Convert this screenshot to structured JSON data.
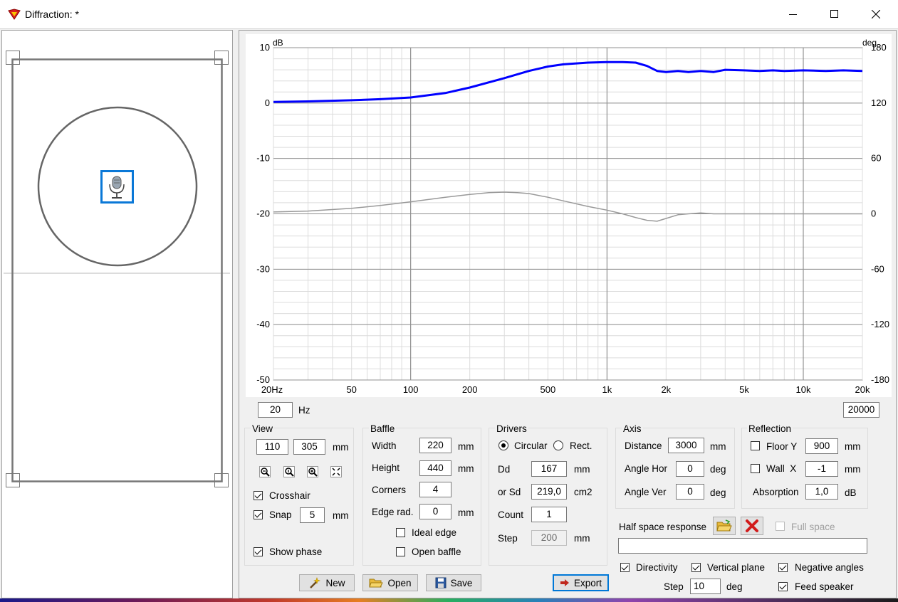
{
  "window": {
    "title": "Diffraction: *"
  },
  "chart_data": {
    "type": "line",
    "xscale": "log",
    "xlim": [
      20,
      20000
    ],
    "ylim": [
      -50,
      10
    ],
    "y2lim": [
      -180,
      180
    ],
    "ylabel": "dB",
    "y2label": "deg",
    "xticks": [
      "20Hz",
      "50",
      "100",
      "200",
      "500",
      "1k",
      "2k",
      "5k",
      "10k",
      "20k"
    ],
    "xtick_values": [
      20,
      50,
      100,
      200,
      500,
      1000,
      2000,
      5000,
      10000,
      20000
    ],
    "yticks": [
      "10",
      "0",
      "-10",
      "-20",
      "-30",
      "-40",
      "-50"
    ],
    "ytick_values": [
      10,
      0,
      -10,
      -20,
      -30,
      -40,
      -50
    ],
    "y2ticks": [
      "180",
      "120",
      "60",
      "0",
      "-60",
      "-120",
      "-180"
    ],
    "y2tick_values": [
      180,
      120,
      60,
      0,
      -60,
      -120,
      -180
    ],
    "grid": true,
    "series": [
      {
        "color": "#0000ff",
        "axis": "left",
        "x": [
          20,
          30,
          50,
          70,
          100,
          150,
          200,
          300,
          400,
          500,
          600,
          800,
          1000,
          1200,
          1400,
          1600,
          1800,
          2000,
          2300,
          2600,
          3000,
          3500,
          4000,
          5000,
          6000,
          7000,
          8000,
          10000,
          13000,
          16000,
          20000
        ],
        "values": [
          0.2,
          0.3,
          0.5,
          0.7,
          1.0,
          1.8,
          2.8,
          4.5,
          5.8,
          6.6,
          7.0,
          7.3,
          7.4,
          7.4,
          7.3,
          6.7,
          5.8,
          5.6,
          5.8,
          5.6,
          5.8,
          5.6,
          6.0,
          5.9,
          5.8,
          5.9,
          5.8,
          5.9,
          5.8,
          5.9,
          5.8
        ]
      },
      {
        "color": "#999999",
        "axis": "right",
        "x": [
          20,
          30,
          50,
          70,
          100,
          150,
          200,
          250,
          300,
          350,
          400,
          500,
          600,
          800,
          1000,
          1200,
          1400,
          1600,
          1800,
          2000,
          2300,
          2600,
          3000,
          3500,
          4000,
          5000,
          7000,
          10000,
          20000
        ],
        "values": [
          2,
          3,
          6,
          9,
          13,
          18,
          21,
          23,
          23.5,
          23,
          22,
          18,
          14,
          8,
          4,
          0,
          -4,
          -7,
          -8,
          -5,
          -1,
          0,
          1,
          0,
          0,
          0,
          0,
          0,
          0
        ]
      }
    ]
  },
  "freq": {
    "min": "20",
    "unit": "Hz",
    "max": "20000"
  },
  "view": {
    "title": "View",
    "x": "110",
    "y": "305",
    "unit": "mm",
    "tools": [
      "zoom-out-icon",
      "zoom-fit-icon",
      "zoom-in-icon",
      "fit-all-icon"
    ],
    "crosshair_label": "Crosshair",
    "crosshair": true,
    "snap_label": "Snap",
    "snap": true,
    "snap_value": "5",
    "snap_unit": "mm",
    "show_phase_label": "Show phase",
    "show_phase": true
  },
  "baffle": {
    "title": "Baffle",
    "width_label": "Width",
    "width": "220",
    "width_unit": "mm",
    "height_label": "Height",
    "height": "440",
    "height_unit": "mm",
    "corners_label": "Corners",
    "corners": "4",
    "edge_label": "Edge rad.",
    "edge": "0",
    "edge_unit": "mm",
    "ideal_edge_label": "Ideal edge",
    "ideal_edge": false,
    "open_baffle_label": "Open baffle",
    "open_baffle": false
  },
  "drivers": {
    "title": "Drivers",
    "circular_label": "Circular",
    "rect_label": "Rect.",
    "shape": "circular",
    "dd_label": "Dd",
    "dd": "167",
    "dd_unit": "mm",
    "sd_label": "or Sd",
    "sd": "219,0",
    "sd_unit": "cm2",
    "count_label": "Count",
    "count": "1",
    "step_label": "Step",
    "step": "200",
    "step_unit": "mm"
  },
  "axis": {
    "title": "Axis",
    "distance_label": "Distance",
    "distance": "3000",
    "distance_unit": "mm",
    "hor_label": "Angle Hor",
    "hor": "0",
    "hor_unit": "deg",
    "ver_label": "Angle Ver",
    "ver": "0",
    "ver_unit": "deg"
  },
  "reflection": {
    "title": "Reflection",
    "floor_label": "Floor Y",
    "floor": false,
    "floor_value": "900",
    "floor_unit": "mm",
    "wall_label": "Wall  X",
    "wall": false,
    "wall_value": "-1",
    "wall_unit": "mm",
    "absorption_label": "Absorption",
    "absorption": "1,0",
    "absorption_unit": "dB"
  },
  "half_space": {
    "label": "Half space response",
    "full_space_label": "Full space",
    "full_space": false,
    "path": ""
  },
  "options": {
    "directivity_label": "Directivity",
    "directivity": true,
    "vertical_label": "Vertical plane",
    "vertical": true,
    "negative_label": "Negative angles",
    "negative": true,
    "feed_label": "Feed speaker",
    "feed": true,
    "step_label": "Step",
    "step": "10",
    "step_unit": "deg"
  },
  "buttons": {
    "new": "New",
    "open": "Open",
    "save": "Save",
    "export": "Export"
  }
}
